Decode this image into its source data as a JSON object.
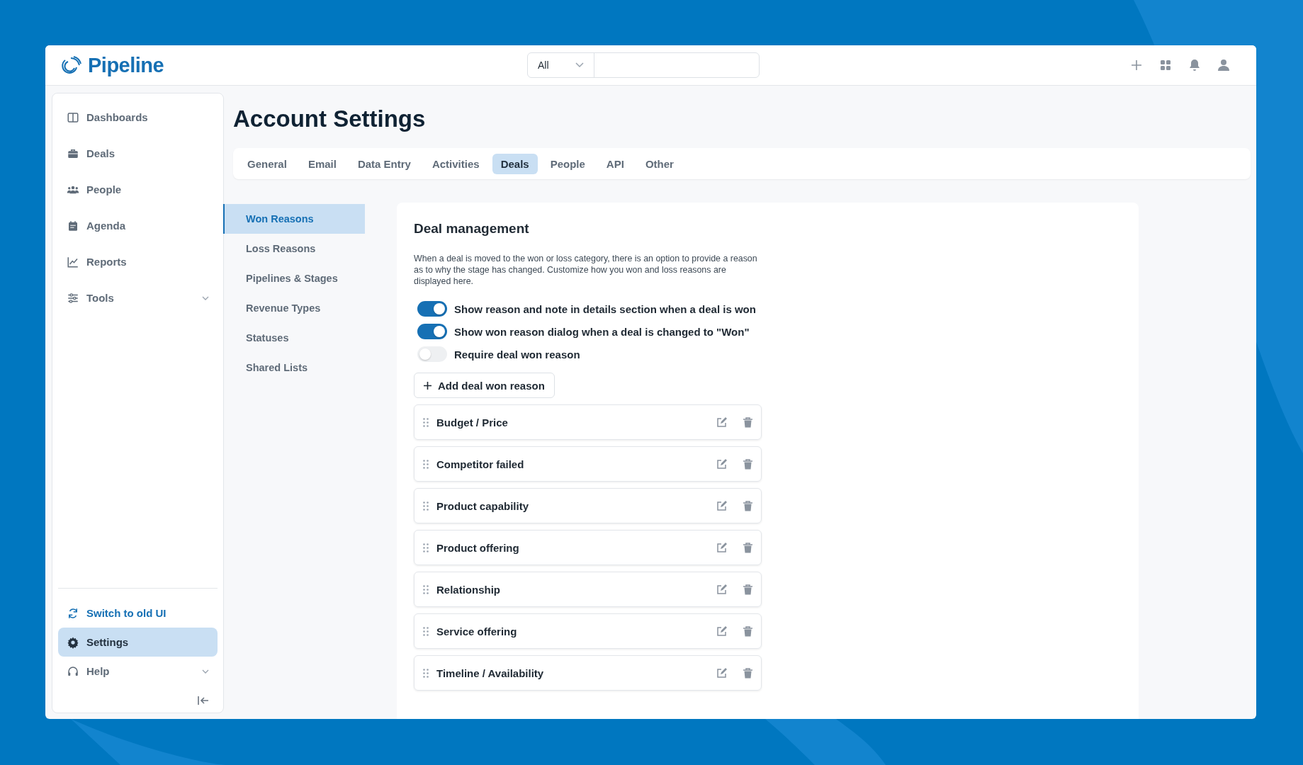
{
  "app": {
    "name": "Pipeline"
  },
  "search": {
    "scope": "All"
  },
  "sidebar": {
    "items": [
      {
        "label": "Dashboards",
        "selected": false,
        "expandable": false
      },
      {
        "label": "Deals",
        "selected": false,
        "expandable": false
      },
      {
        "label": "People",
        "selected": false,
        "expandable": false
      },
      {
        "label": "Agenda",
        "selected": false,
        "expandable": false
      },
      {
        "label": "Reports",
        "selected": false,
        "expandable": false
      },
      {
        "label": "Tools",
        "selected": false,
        "expandable": true
      }
    ],
    "bottom_items": [
      {
        "label": "Switch to old UI",
        "kind": "link",
        "selected": false,
        "expandable": false
      },
      {
        "label": "Settings",
        "kind": "item",
        "selected": true,
        "expandable": false
      },
      {
        "label": "Help",
        "kind": "item",
        "selected": false,
        "expandable": true
      }
    ]
  },
  "page": {
    "title": "Account Settings"
  },
  "tabs": [
    {
      "label": "General",
      "selected": false
    },
    {
      "label": "Email",
      "selected": false
    },
    {
      "label": "Data Entry",
      "selected": false
    },
    {
      "label": "Activities",
      "selected": false
    },
    {
      "label": "Deals",
      "selected": true
    },
    {
      "label": "People",
      "selected": false
    },
    {
      "label": "API",
      "selected": false
    },
    {
      "label": "Other",
      "selected": false
    }
  ],
  "submenu": [
    {
      "label": "Won Reasons",
      "selected": true
    },
    {
      "label": "Loss Reasons",
      "selected": false
    },
    {
      "label": "Pipelines & Stages",
      "selected": false
    },
    {
      "label": "Revenue Types",
      "selected": false
    },
    {
      "label": "Statuses",
      "selected": false
    },
    {
      "label": "Shared Lists",
      "selected": false
    }
  ],
  "section": {
    "title": "Deal management",
    "description": "When a deal is moved to the won or loss category, there is an option to provide a reason as to why the stage has changed. Customize how you won and loss reasons are displayed here.",
    "toggles": [
      {
        "label": "Show reason and note in details section when a deal is won",
        "on": true
      },
      {
        "label": "Show won reason dialog when a deal is changed to \"Won\"",
        "on": true
      },
      {
        "label": "Require deal won reason",
        "on": false
      }
    ],
    "add_button": "Add deal won reason",
    "reasons": [
      "Budget / Price",
      "Competitor failed",
      "Product capability",
      "Product offering",
      "Relationship",
      "Service offering",
      "Timeline / Availability"
    ]
  }
}
